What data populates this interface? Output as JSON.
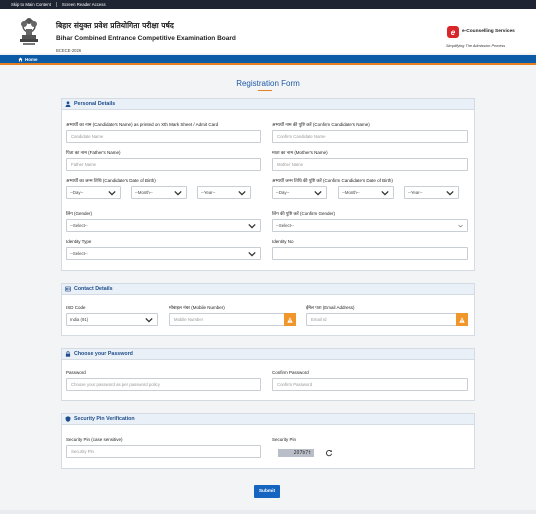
{
  "topbar": {
    "skip_main": "Skip to Main Content",
    "screen_reader": "Screen Reader Access"
  },
  "header": {
    "title_hindi": "बिहार संयुक्त प्रवेश प्रतियोगिता परीक्षा पर्षद",
    "title_english": "Bihar Combined Entrance Competitive Examination Board",
    "exam_code": "BCECE-2026",
    "partner_logo_letter": "e",
    "partner_name": "e-Counselling Services",
    "partner_tagline": "Simplifying The Admission Process"
  },
  "nav": {
    "home": "Home"
  },
  "form": {
    "title": "Registration Form",
    "submit_label": "Submit"
  },
  "personal": {
    "heading": "Personal Details",
    "candidate_name_label": "अभ्यर्थी का नाम (Candidate's Name) as printed on Xth Mark Sheet / Admit Card",
    "candidate_name_placeholder": "Candidate Name",
    "confirm_name_label": "अभ्यर्थी नाम की पुष्टि करें (Confirm Candidate's Name)",
    "confirm_name_placeholder": "Confirm Candidate Name",
    "father_label": "पिता का नाम (Father's Name)",
    "father_placeholder": "Father Name",
    "mother_label": "माता का नाम (Mother's Name)",
    "mother_placeholder": "Mother Name",
    "dob_label": "अभ्यर्थी का जन्म तिथि (Candidate's Date of Birth)",
    "confirm_dob_label": "अभ्यर्थी जन्म तिथि की पुष्टि करें (Confirm Candidate's Date of Birth)",
    "day": "--Day--",
    "month": "--Month--",
    "year": "--Year--",
    "gender_label": "लिंग (Gender)",
    "gender_value": "--Select--",
    "confirm_gender_label": "लिंग की पुष्टि करें (Confirm Gender)",
    "confirm_gender_value": "--Select--",
    "identity_type_label": "Identity Type",
    "identity_type_value": "--Select--",
    "identity_no_label": "Identity No"
  },
  "contact": {
    "heading": "Contact Details",
    "isd_label": "ISD Code",
    "isd_value": "India (91)",
    "mobile_label": "मोबाइल नंबर (Mobile Number)",
    "mobile_placeholder": "Mobile Number",
    "email_label": "ईमेल पता (Email Address)",
    "email_placeholder": "Email Id"
  },
  "password": {
    "heading": "Choose your Password",
    "password_label": "Password",
    "password_placeholder": "Choose your password as per password policy",
    "confirm_label": "Confirm Password",
    "confirm_placeholder": "Confirm Password"
  },
  "security": {
    "heading": "Security Pin Verification",
    "pin_label": "Security Pin (case sensitive)",
    "pin_placeholder": "Security Pin",
    "pin_display_label": "Security Pin",
    "captcha_text": "2O7b7t"
  },
  "colors": {
    "primary": "#0b5aa6",
    "accent": "#e67e22",
    "warning": "#f0962a",
    "submit": "#1565c0"
  }
}
